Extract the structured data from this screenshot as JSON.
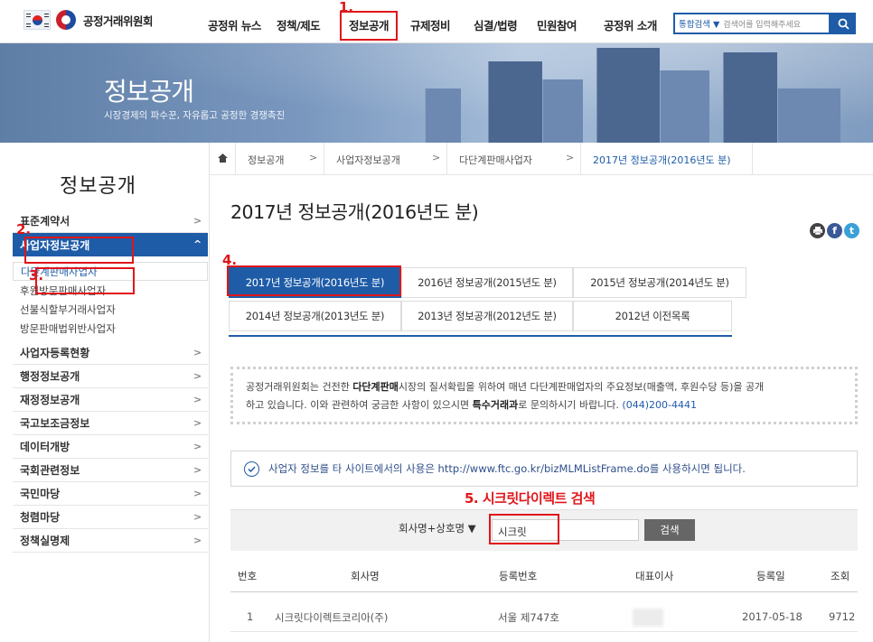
{
  "header": {
    "org_name": "공정거래위원회",
    "nav": [
      "공정위 뉴스",
      "정책/제도",
      "정보공개",
      "규제정비",
      "심결/법령",
      "민원참여",
      "공정위 소개"
    ],
    "search": {
      "scope": "통합검색",
      "placeholder": "검색어를 입력해주세요"
    }
  },
  "banner": {
    "title": "정보공개",
    "subtitle": "시장경제의 파수꾼, 자유롭고 공정한 경쟁촉진"
  },
  "sidebar": {
    "title": "정보공개",
    "items": [
      {
        "label": "표준계약서"
      },
      {
        "label": "사업자정보공개",
        "active": true
      },
      {
        "label": "사업자등록현황"
      },
      {
        "label": "행정정보공개"
      },
      {
        "label": "재정정보공개"
      },
      {
        "label": "국고보조금정보"
      },
      {
        "label": "데이터개방"
      },
      {
        "label": "국회관련정보"
      },
      {
        "label": "국민마당"
      },
      {
        "label": "청렴마당"
      },
      {
        "label": "정책실명제"
      }
    ],
    "subitems": [
      "다단계판매사업자",
      "후원방문판매사업자",
      "선불식할부거래사업자",
      "방문판매법위반사업자"
    ]
  },
  "breadcrumb": [
    "정보공개",
    "사업자정보공개",
    "다단계판매사업자",
    "2017년 정보공개(2016년도 분)"
  ],
  "page": {
    "title": "2017년 정보공개(2016년도 분)"
  },
  "tabs": [
    "2017년 정보공개(2016년도 분)",
    "2016년 정보공개(2015년도 분)",
    "2015년 정보공개(2014년도 분)",
    "2014년 정보공개(2013년도 분)",
    "2013년 정보공개(2012년도 분)",
    "2012년 이전목록"
  ],
  "notice": {
    "p1": "공정거래위원회는 건전한 ",
    "b1": "다단계판매",
    "p2": "시장의 질서확립을 위하여 매년 다단계판매업자의 주요정보(매출액, 후원수당 등)을 공개",
    "p3": "하고 있습니다. 이와 관련하여 궁금한 사항이 있으시면 ",
    "b2": "특수거래과",
    "p4": "로 문의하시기 바랍니다. ",
    "tel": "(044)200-4441"
  },
  "tip": "사업자 정보를 타 사이트에서의 사용은 http://www.ftc.go.kr/bizMLMListFrame.do를 사용하시면 됩니다.",
  "annotations": {
    "n1": "1.",
    "n2": "2.",
    "n3": "3.",
    "n4": "4.",
    "step5": "5. 시크릿다이렉트 검색"
  },
  "filter": {
    "select": "회사명+상호명",
    "value": "시크릿",
    "button": "검색"
  },
  "table": {
    "headers": [
      "번호",
      "회사명",
      "등록번호",
      "대표이사",
      "등록일",
      "조회"
    ],
    "rows": [
      {
        "no": "1",
        "company": "시크릿다이렉트코리아(주)",
        "reg_no": "서울 제747호",
        "ceo": "",
        "date": "2017-05-18",
        "views": "9712"
      }
    ]
  },
  "colors": {
    "primary": "#1f5ca8",
    "annotation": "#e0161a"
  }
}
